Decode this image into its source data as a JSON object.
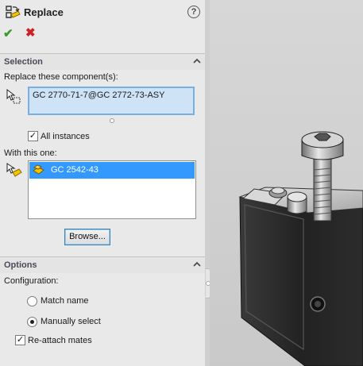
{
  "header": {
    "title": "Replace",
    "help_glyph": "?",
    "ok_glyph": "✔",
    "cancel_glyph": "✖"
  },
  "selection": {
    "section_label": "Selection",
    "replace_label": "Replace these component(s):",
    "replace_value": "GC 2770-71-7@GC 2772-73-ASY",
    "all_instances_label": "All instances",
    "all_instances_checked": true,
    "with_label": "With this one:",
    "with_items": [
      "GC 2542-43"
    ],
    "browse_label": "Browse..."
  },
  "options": {
    "section_label": "Options",
    "configuration_label": "Configuration:",
    "match_name_label": "Match name",
    "manually_select_label": "Manually select",
    "selected_configuration": "Manually select",
    "reattach_label": "Re-attach mates",
    "reattach_checked": true
  },
  "colors": {
    "selected_row": "#3399ff",
    "selection_box": "#cfe3f7",
    "ok": "#3a9a2a",
    "cancel": "#cc2222"
  },
  "icons": {
    "title": "replace-components-icon",
    "replace_field": "component-select-icon",
    "with_field": "part-icon"
  }
}
